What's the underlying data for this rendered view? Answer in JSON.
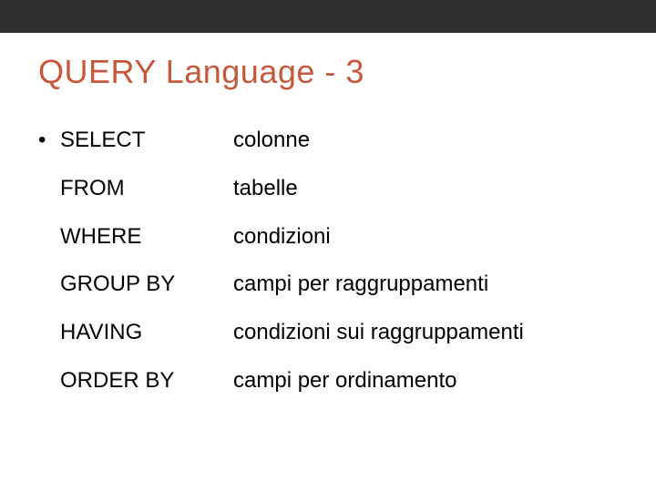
{
  "title": "QUERY Language - 3",
  "rows": [
    {
      "bullet": "•",
      "keyword": "SELECT",
      "desc": "colonne"
    },
    {
      "bullet": "",
      "keyword": "FROM",
      "desc": "tabelle"
    },
    {
      "bullet": "",
      "keyword": "WHERE",
      "desc": "condizioni"
    },
    {
      "bullet": "",
      "keyword": "GROUP BY",
      "desc": "campi per raggruppamenti"
    },
    {
      "bullet": "",
      "keyword": "HAVING",
      "desc": "condizioni sui raggruppamenti"
    },
    {
      "bullet": "",
      "keyword": "ORDER BY",
      "desc": "campi per ordinamento"
    }
  ]
}
